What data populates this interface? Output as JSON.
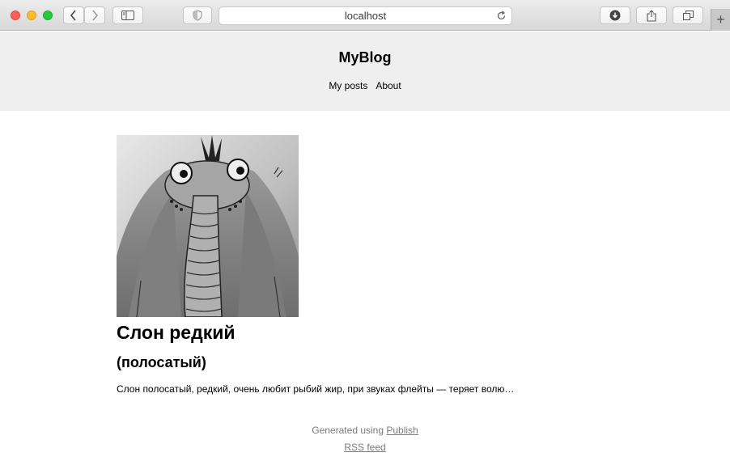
{
  "browser": {
    "address": "localhost",
    "icons": {
      "back": "chevron-left-icon",
      "forward": "chevron-right-icon",
      "sidebar": "sidebar-icon",
      "privacy": "shield-icon",
      "reload": "reload-icon",
      "download": "download-icon",
      "share": "share-icon",
      "tabs": "tabs-icon",
      "newtab": "plus-icon"
    },
    "newtab_label": "+"
  },
  "site": {
    "title": "MyBlog",
    "nav": [
      "My posts",
      "About"
    ]
  },
  "post": {
    "title": "Слон редкий",
    "subtitle": "(полосатый)",
    "excerpt": "Слон полосатый, редкий, очень любит рыбий жир, при звуках флейты — теряет волю…"
  },
  "footer": {
    "generated_prefix": "Generated using ",
    "generated_link": "Publish",
    "rss": "RSS feed"
  },
  "colors": {
    "header_bg": "#efefef",
    "footer_text": "#7a7a7a"
  }
}
